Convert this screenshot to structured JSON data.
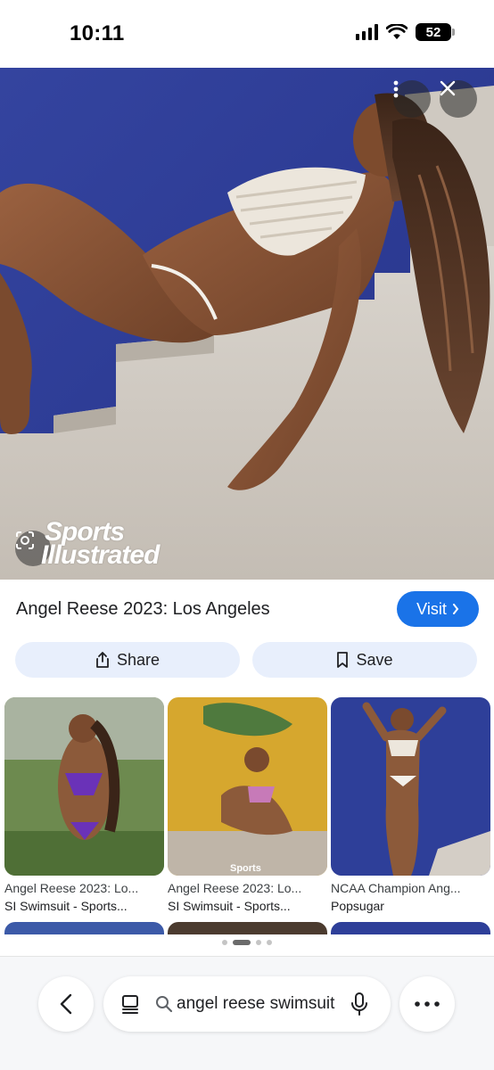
{
  "status_bar": {
    "time": "10:11",
    "battery": "52",
    "icons": [
      "signal-icon",
      "wifi-icon",
      "battery-icon"
    ]
  },
  "viewer": {
    "watermark_line1": "Sports",
    "watermark_line2": "Illustrated",
    "buttons": [
      "more-vert-icon",
      "close-icon",
      "lens-icon"
    ]
  },
  "result": {
    "title": "Angel Reese 2023: Los Angeles",
    "visit_label": "Visit",
    "share_label": "Share",
    "save_label": "Save"
  },
  "related": [
    {
      "title": "Angel Reese 2023: Lo...",
      "source": "SI Swimsuit - Sports..."
    },
    {
      "title": "Angel Reese 2023: Lo...",
      "source": "SI Swimsuit - Sports..."
    },
    {
      "title": "NCAA Champion Ang...",
      "source": "Popsugar"
    }
  ],
  "bottom_bar": {
    "search_text": "angel reese swimsuit",
    "icons": [
      "back-icon",
      "tabs-icon",
      "search-icon",
      "mic-icon",
      "more-horiz-icon"
    ]
  },
  "colors": {
    "accent": "#1a73e8",
    "chip_bg": "#e8effc",
    "hero_wall": "#2f3f9b"
  },
  "pagination": {
    "total": 4,
    "active": 1
  }
}
